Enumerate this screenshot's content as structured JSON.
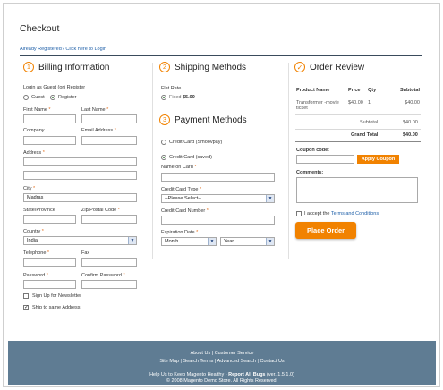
{
  "page": {
    "title": "Checkout",
    "login_link": "Already Registered? Click here to Login"
  },
  "billing": {
    "step": "1",
    "heading": "Billing Information",
    "login_prompt": "Login as Guest (or) Register",
    "guest_label": "Guest",
    "register_label": "Register",
    "first_name_label": "First Name",
    "last_name_label": "Last Name",
    "company_label": "Company",
    "email_label": "Email Address",
    "address_label": "Address",
    "city_label": "City",
    "city_value": "Madras",
    "state_label": "State/Province",
    "zip_label": "Zip/Postal Code",
    "country_label": "Country",
    "country_value": "India",
    "telephone_label": "Telephone",
    "fax_label": "Fax",
    "password_label": "Password",
    "confirm_password_label": "Confirm Password",
    "newsletter_label": "Sign Up for Newsletter",
    "ship_same_label": "Ship to same Address",
    "required_mark": "*"
  },
  "shipping": {
    "step": "2",
    "heading": "Shipping Methods",
    "method_title": "Flat Rate",
    "method_option": "Fixed",
    "method_price": "$5.00"
  },
  "payment": {
    "step": "3",
    "heading": "Payment Methods",
    "option1": "Credit Card (Smoovpay)",
    "option2": "Credit Card (saved)",
    "name_on_card_label": "Name on Card",
    "card_type_label": "Credit Card Type",
    "card_type_value": "--Please Select--",
    "card_number_label": "Credit Card Number",
    "expiration_label": "Expiration Date",
    "month_value": "Month",
    "year_value": "Year"
  },
  "review": {
    "icon": "checkmark-icon",
    "heading": "Order Review",
    "columns": [
      "Product Name",
      "Price",
      "Qty",
      "Subtotal"
    ],
    "item": {
      "name": "Transformer -movie ticket",
      "price": "$40.00",
      "qty": "1",
      "subtotal": "$40.00"
    },
    "subtotal_label": "Subtotal",
    "subtotal_value": "$40.00",
    "grand_total_label": "Grand Total",
    "grand_total_value": "$40.00",
    "coupon_label": "Coupon code:",
    "apply_coupon": "Apply Coupon",
    "comments_label": "Comments:",
    "terms_prefix": "I accept the",
    "terms_link": "Terms and Conditions",
    "place_order": "Place Order"
  },
  "footer": {
    "links1": [
      "About Us",
      "Customer Service"
    ],
    "links2": [
      "Site Map",
      "Search Terms",
      "Advanced Search",
      "Contact Us"
    ],
    "help_text": "Help Us to Keep Magento Healthy -",
    "report_bugs": "Report All Bugs",
    "version": "(ver. 1.5.1.0)",
    "copyright": "© 2008 Magento Demo Store. All Rights Reserved."
  },
  "colors": {
    "accent": "#f18200",
    "link": "#1e5fa8",
    "footer_bg": "#5f7c93"
  }
}
